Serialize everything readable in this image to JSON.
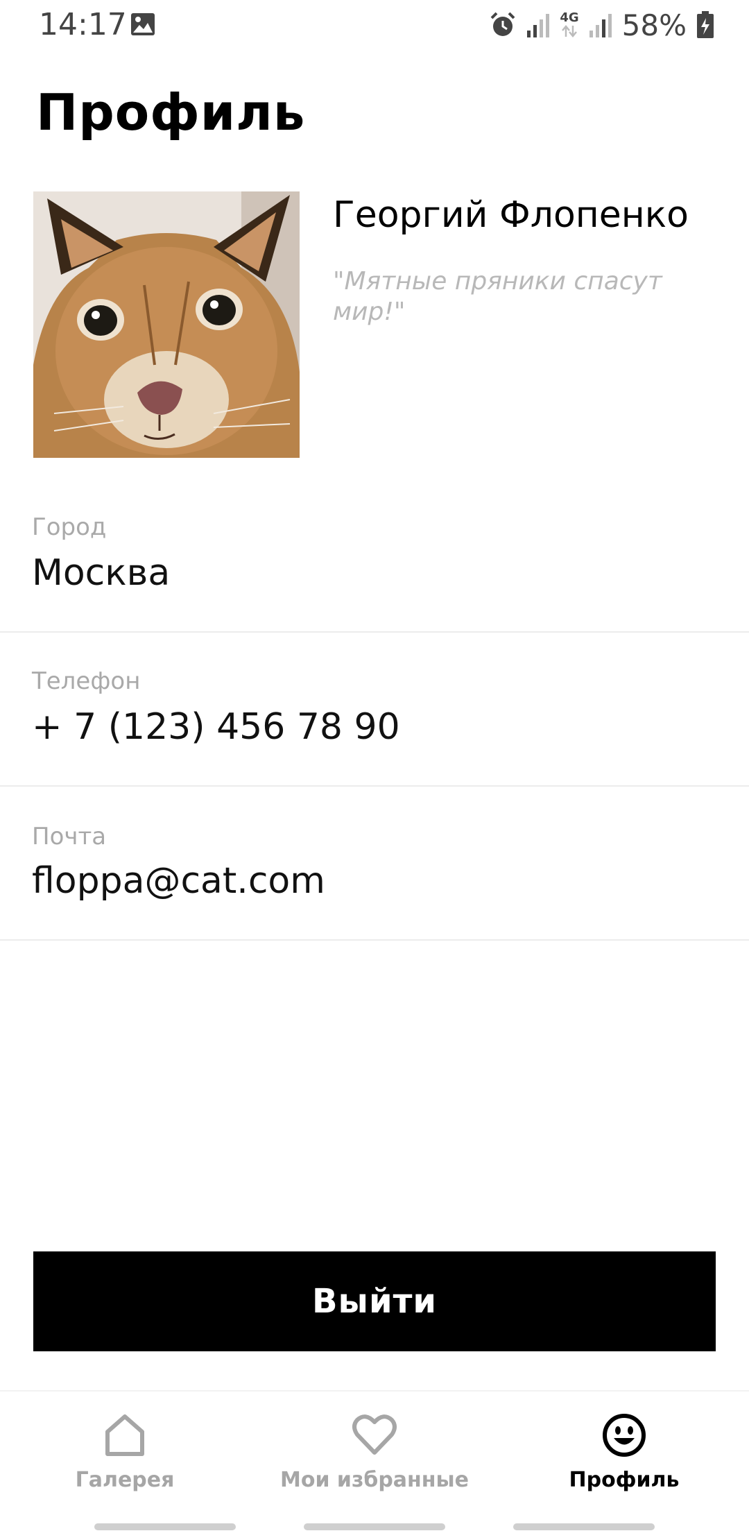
{
  "status_bar": {
    "time": "14:17",
    "network_label": "4G",
    "battery_percent": "58%",
    "icons": [
      "image-icon",
      "alarm-icon",
      "signal-icon",
      "data-arrows-icon",
      "signal-icon",
      "battery-icon"
    ]
  },
  "page": {
    "title": "Профиль"
  },
  "profile": {
    "name": "Георгий Флопенко",
    "quote": "\"Мятные пряники спасут мир!\""
  },
  "fields": [
    {
      "label": "Город",
      "value": "Москва"
    },
    {
      "label": "Телефон",
      "value": "+ 7 (123) 456 78 90"
    },
    {
      "label": "Почта",
      "value": "floppa@cat.com"
    }
  ],
  "actions": {
    "logout_label": "Выйти"
  },
  "bottom_nav": {
    "items": [
      {
        "label": "Галерея",
        "icon": "home-icon",
        "active": false
      },
      {
        "label": "Мои избранные",
        "icon": "heart-icon",
        "active": false
      },
      {
        "label": "Профиль",
        "icon": "smiley-icon",
        "active": true
      }
    ]
  },
  "colors": {
    "accent": "#000000",
    "muted_text": "#a9a9a9",
    "quote_text": "#b8b8b8",
    "divider": "#ececec"
  }
}
